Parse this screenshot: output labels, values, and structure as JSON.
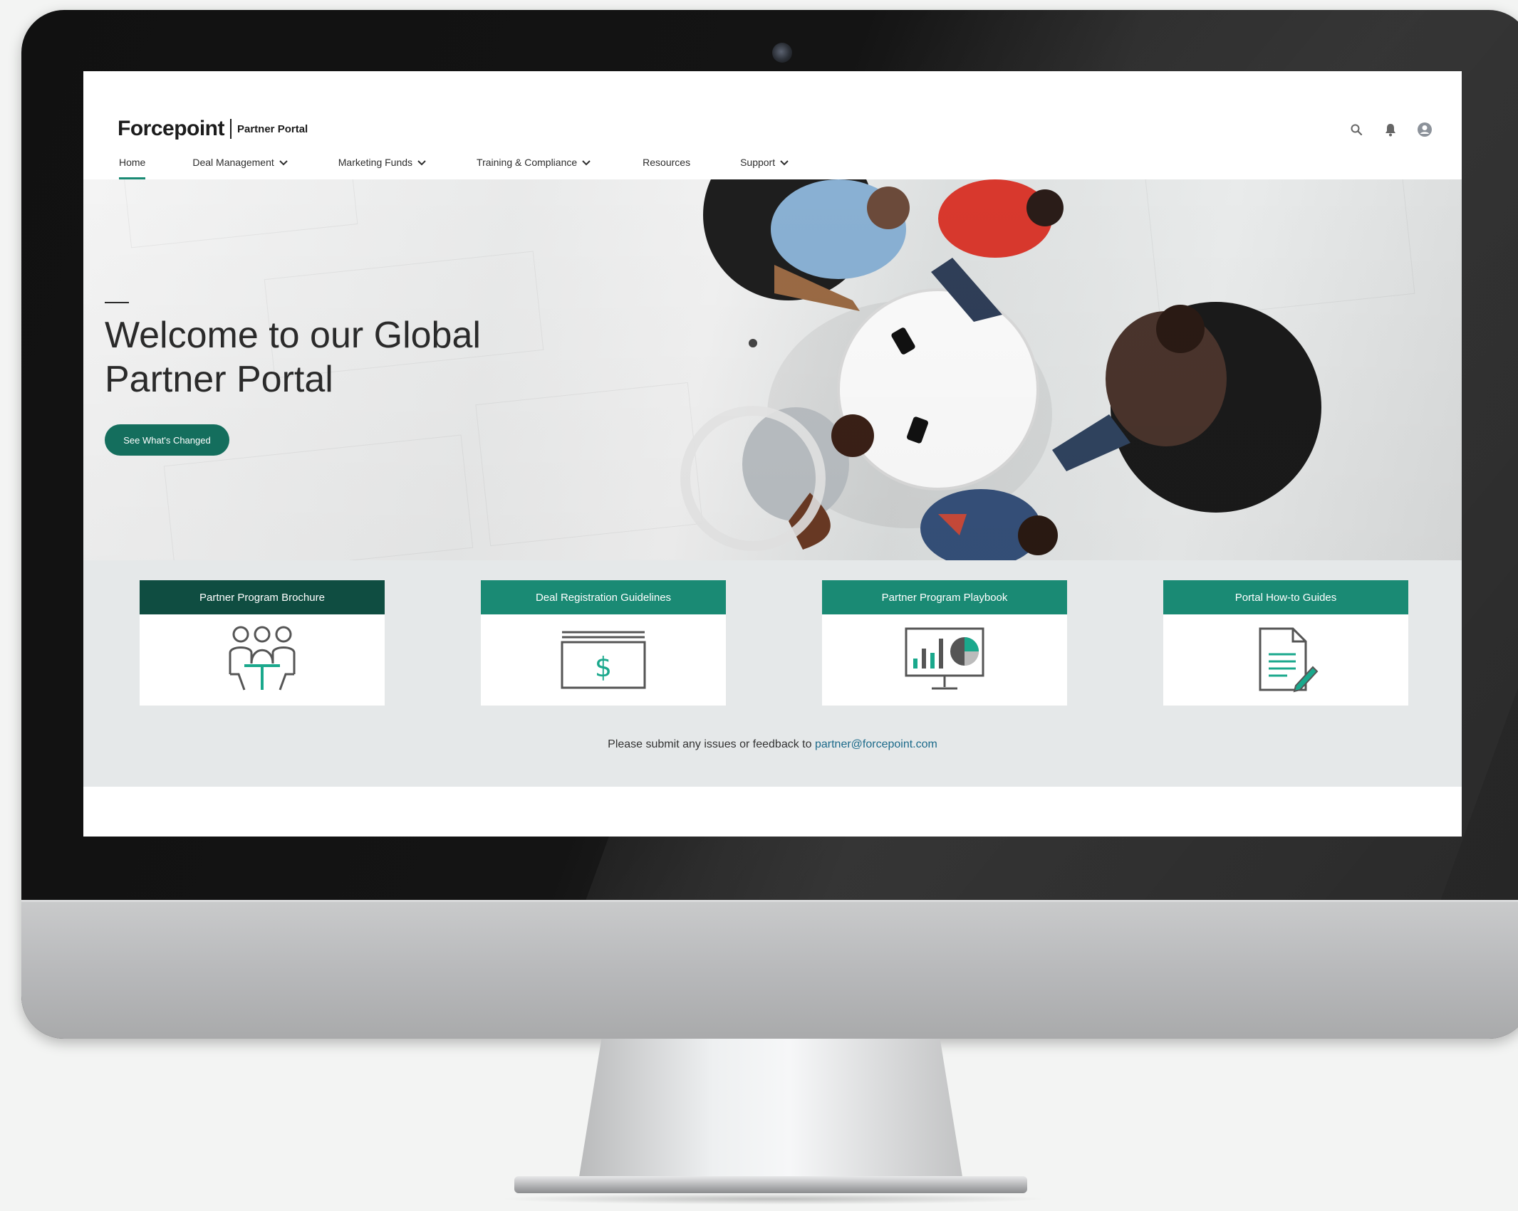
{
  "brand": {
    "logo_text": "Forcepoint",
    "portal_label": "Partner Portal",
    "accent_color": "#1a8a74",
    "dark_green": "#0f4d41"
  },
  "header_icons": [
    "search-icon",
    "bell-icon",
    "user-avatar-icon"
  ],
  "nav": {
    "items": [
      {
        "label": "Home",
        "active": true,
        "dropdown": false
      },
      {
        "label": "Deal Management",
        "dropdown": true
      },
      {
        "label": "Marketing Funds",
        "dropdown": true
      },
      {
        "label": "Training & Compliance",
        "dropdown": true
      },
      {
        "label": "Resources",
        "dropdown": false
      },
      {
        "label": "Support",
        "dropdown": true
      }
    ]
  },
  "hero": {
    "title_line1": "Welcome to our Global",
    "title_line2": "Partner Portal",
    "button_label": "See What's Changed"
  },
  "cards": [
    {
      "title": "Partner Program Brochure",
      "icon": "people-meeting-icon"
    },
    {
      "title": "Deal Registration Guidelines",
      "icon": "dollar-document-icon"
    },
    {
      "title": "Partner Program Playbook",
      "icon": "chart-monitor-icon"
    },
    {
      "title": "Portal How-to Guides",
      "icon": "document-pen-icon"
    }
  ],
  "feedback": {
    "text": "Please submit any issues or feedback to",
    "email": "partner@forcepoint.com"
  }
}
